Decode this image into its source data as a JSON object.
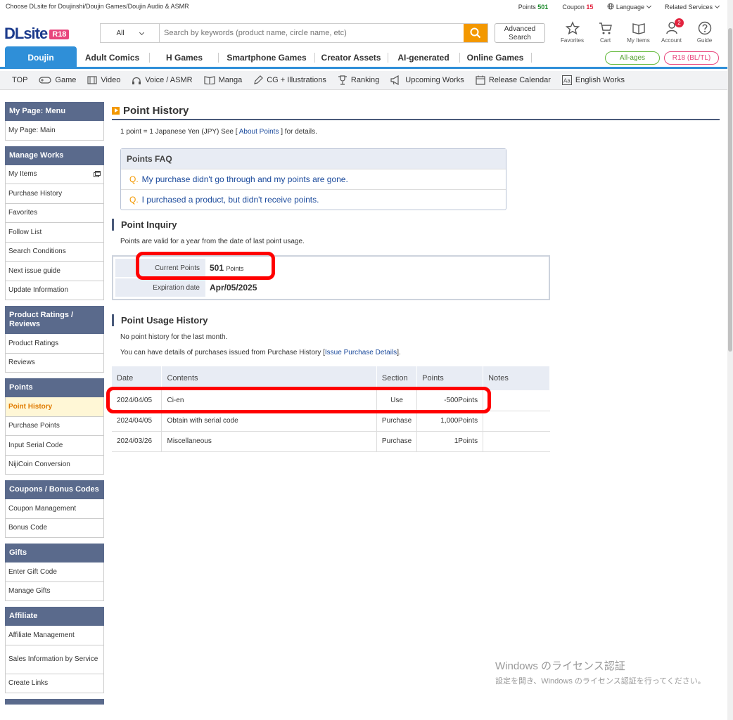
{
  "topbar": {
    "tagline": "Choose DLsite for Doujinshi/Doujin Games/Doujin Audio & ASMR",
    "points_label": "Points",
    "points_value": "501",
    "coupon_label": "Coupon",
    "coupon_value": "15",
    "language": "Language",
    "related": "Related Services"
  },
  "header": {
    "logo": "DLsite",
    "logo_badge": "R18",
    "search_category": "All",
    "search_placeholder": "Search by keywords (product name, circle name, etc)",
    "advanced_search": "Advanced Search",
    "icons": [
      {
        "label": "Favorites",
        "icon": "star-icon"
      },
      {
        "label": "Cart",
        "icon": "cart-icon"
      },
      {
        "label": "My Items",
        "icon": "book-icon"
      },
      {
        "label": "Account",
        "icon": "user-icon",
        "badge": "2"
      },
      {
        "label": "Guide",
        "icon": "help-icon"
      }
    ]
  },
  "main_nav": {
    "tabs": [
      "Doujin",
      "Adult Comics",
      "H Games",
      "Smartphone Games",
      "Creator Assets",
      "AI-generated",
      "Online Games"
    ],
    "all_ages": "All-ages",
    "r18": "R18 (BL/TL)"
  },
  "sub_nav": [
    "TOP",
    "Game",
    "Video",
    "Voice / ASMR",
    "Manga",
    "CG + Illustrations",
    "Ranking",
    "Upcoming Works",
    "Release Calendar",
    "English Works"
  ],
  "sidebar": [
    {
      "title": "My Page: Menu",
      "items": [
        "My Page: Main"
      ]
    },
    {
      "title": "Manage Works",
      "items": [
        "My Items",
        "Purchase History",
        "Favorites",
        "Follow List",
        "Search Conditions",
        "Next issue guide",
        "Update Information"
      ]
    },
    {
      "title": "Product Ratings / Reviews",
      "items": [
        "Product Ratings",
        "Reviews"
      ]
    },
    {
      "title": "Points",
      "items": [
        "Point History",
        "Purchase Points",
        "Input Serial Code",
        "NijiCoin Conversion"
      ]
    },
    {
      "title": "Coupons / Bonus Codes",
      "items": [
        "Coupon Management",
        "Bonus Code"
      ]
    },
    {
      "title": "Gifts",
      "items": [
        "Enter Gift Code",
        "Manage Gifts"
      ]
    },
    {
      "title": "Affiliate",
      "items": [
        "Affiliate Management",
        "Sales Information by Service",
        "Create Links"
      ]
    }
  ],
  "content": {
    "title": "Point History",
    "rate_prefix": "1 point = 1 Japanese Yen (JPY) See [",
    "rate_link": " About Points ",
    "rate_suffix": "] for details.",
    "faq_title": "Points FAQ",
    "faq": [
      "My purchase didn't go through and my points are gone.",
      "I purchased a product, but didn't receive points."
    ],
    "faq_q": "Q.",
    "inquiry_title": "Point Inquiry",
    "inquiry_note": "Points are valid for a year from the date of last point usage.",
    "current_points_label": "Current Points",
    "current_points_value": "501",
    "current_points_unit": "Points",
    "expiration_label": "Expiration date",
    "expiration_value": "Apr/05/2025",
    "usage_title": "Point Usage History",
    "no_history": "No point history for the last month.",
    "details_prefix": "You can have details of purchases issued from Purchase History [",
    "details_link": "Issue Purchase Details",
    "details_suffix": "].",
    "table_headers": [
      "Date",
      "Contents",
      "Section",
      "Points",
      "Notes"
    ],
    "rows": [
      {
        "date": "2024/04/05",
        "contents": "Ci-en",
        "section": "Use",
        "points": "-500Points",
        "notes": ""
      },
      {
        "date": "2024/04/05",
        "contents": "Obtain with serial code",
        "section": "Purchase",
        "points": "1,000Points",
        "notes": ""
      },
      {
        "date": "2024/03/26",
        "contents": "Miscellaneous",
        "section": "Purchase",
        "points": "1Points",
        "notes": ""
      }
    ]
  },
  "watermark": {
    "line1": "Windows のライセンス認証",
    "line2": "設定を開き、Windows のライセンス認証を行ってください。"
  }
}
